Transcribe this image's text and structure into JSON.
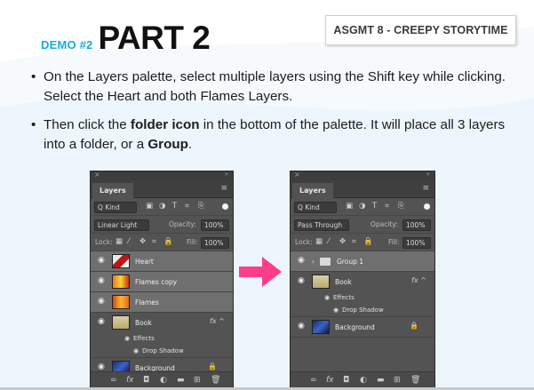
{
  "header": {
    "demo_label": "DEMO #2",
    "part_title": "PART 2",
    "assignment_badge": "ASGMT 8 - CREEPY STORYTIME"
  },
  "bullets": [
    {
      "dot": "•",
      "pre": "On the Layers palette, select multiple layers using the Shift key while clicking. Select the Heart and both Flames Layers."
    },
    {
      "dot": "•",
      "pre": "Then click the ",
      "bold1": "folder icon",
      "mid": " in the bottom of the palette. It will place all 3 layers into a folder, or a ",
      "bold2": "Group",
      "post": "."
    }
  ],
  "colors": {
    "demo_label": "#19a9e1",
    "arrow": "#ff3d8b",
    "panel_bg": "#535353"
  },
  "before_panel": {
    "close_glyph": "×",
    "collapse_glyph": "»",
    "tab": "Layers",
    "menu_icon": "≡",
    "kind_field": "Q Kind",
    "filter_icons": [
      "▣",
      "◑",
      "T",
      "⌗",
      "⎘"
    ],
    "blend_mode": "Linear Light",
    "opacity_label": "Opacity:",
    "opacity_value": "100%",
    "lock_label": "Lock:",
    "lock_icons": [
      "▦",
      "⁄",
      "✥",
      "⌗",
      "🔒"
    ],
    "fill_label": "Fill:",
    "fill_value": "100%",
    "layers": [
      {
        "name": "Heart",
        "selected": true
      },
      {
        "name": "Flames copy",
        "selected": true
      },
      {
        "name": "Flames",
        "selected": true
      },
      {
        "name": "Book",
        "selected": false,
        "fx": "fx ^"
      },
      {
        "name": "Background",
        "selected": false,
        "lock": "🔒"
      }
    ],
    "sub_effects": "Effects",
    "sub_drop_shadow": "Drop Shadow",
    "footer_icons": [
      "∞",
      "fx",
      "◘",
      "◐",
      "▬",
      "⊞",
      "🗑"
    ]
  },
  "after_panel": {
    "close_glyph": "×",
    "collapse_glyph": "»",
    "tab": "Layers",
    "menu_icon": "≡",
    "kind_field": "Q Kind",
    "filter_icons": [
      "▣",
      "◑",
      "T",
      "⌗",
      "⎘"
    ],
    "blend_mode": "Pass Through",
    "opacity_label": "Opacity:",
    "opacity_value": "100%",
    "lock_label": "Lock:",
    "lock_icons": [
      "▦",
      "⁄",
      "✥",
      "⌗",
      "🔒"
    ],
    "fill_label": "Fill:",
    "fill_value": "100%",
    "layers": [
      {
        "name": "Group 1",
        "selected": true,
        "chevron": "›"
      },
      {
        "name": "Book",
        "selected": false,
        "fx": "fx ^"
      },
      {
        "name": "Background",
        "selected": false,
        "lock": "🔒"
      }
    ],
    "sub_effects": "Effects",
    "sub_drop_shadow": "Drop Shadow",
    "footer_icons": [
      "∞",
      "fx",
      "◘",
      "◐",
      "▬",
      "⊞",
      "🗑"
    ]
  }
}
